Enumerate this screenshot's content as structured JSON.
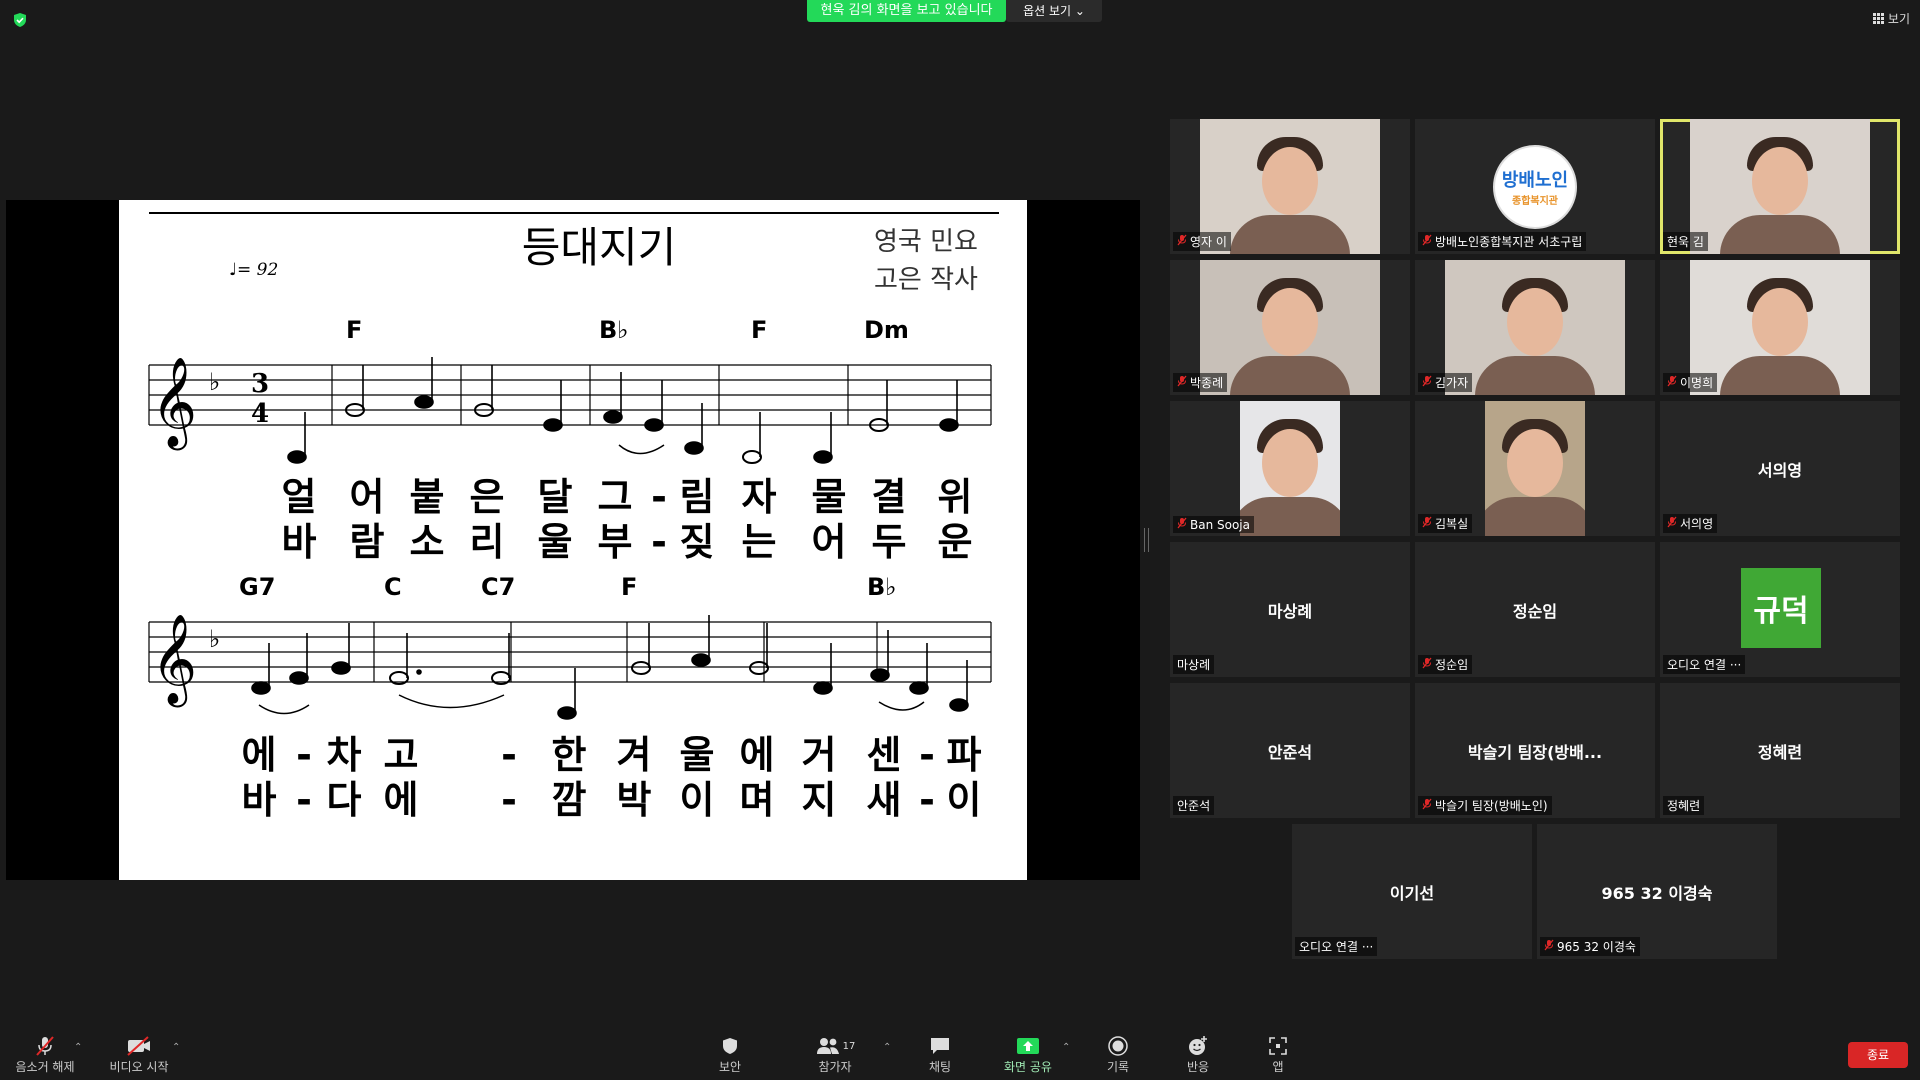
{
  "meeting": {
    "sharing_banner": "현욱 김의 화면을 보고 있습니다",
    "view_options": "옵션 보기",
    "view_button": "보기"
  },
  "sheet": {
    "title": "등대지기",
    "origin": "영국 민요",
    "lyricist": "고은 작사",
    "tempo": "♩= 92",
    "row1_chords": [
      "F",
      "B♭",
      "F",
      "Dm"
    ],
    "row1_lyrics_1": [
      "얼",
      "어",
      "붙",
      "은",
      "달",
      "그",
      "-",
      "림",
      "자",
      "물",
      "결",
      "위"
    ],
    "row1_lyrics_2": [
      "바",
      "람",
      "소",
      "리",
      "울",
      "부",
      "-",
      "짖",
      "는",
      "어",
      "두",
      "운"
    ],
    "row2_chords": [
      "G7",
      "C",
      "C7",
      "F",
      "B♭"
    ],
    "row2_lyrics_1": [
      "에",
      "-",
      "차",
      "고",
      "-",
      "한",
      "겨",
      "울",
      "에",
      "거",
      "센",
      "-",
      "파"
    ],
    "row2_lyrics_2": [
      "바",
      "-",
      "다",
      "에",
      "-",
      "깜",
      "박",
      "이",
      "며",
      "지",
      "새",
      "-",
      "이"
    ]
  },
  "participants": [
    {
      "name": "영자 이",
      "video": true,
      "muted": true,
      "bg": "#d8d0c8"
    },
    {
      "name": "방배노인종합복지관 서초구립",
      "video": true,
      "muted": true,
      "logo_text": "방배노인",
      "logo_sub": "종합복지관",
      "bg": "#ffffff"
    },
    {
      "name": "현욱 김",
      "video": true,
      "muted": false,
      "active": true,
      "bg": "#d9d2cc"
    },
    {
      "name": "박종례",
      "video": true,
      "muted": true,
      "bg": "#c8c0b8"
    },
    {
      "name": "김가자",
      "video": true,
      "muted": true,
      "bg": "#cfc7bf"
    },
    {
      "name": "이명희",
      "video": true,
      "muted": true,
      "bg": "#e0dcd8"
    },
    {
      "name": "Ban Sooja",
      "video": true,
      "muted": true,
      "bg": "#e6e6e8"
    },
    {
      "name": "김복실",
      "video": true,
      "muted": true,
      "bg": "#b7a58a"
    },
    {
      "name": "서의영",
      "video": false,
      "muted": true,
      "center": "서의영"
    },
    {
      "name": "마상례",
      "video": false,
      "muted": false,
      "center": "마상례"
    },
    {
      "name": "정순임",
      "video": false,
      "muted": true,
      "center": "정순임"
    },
    {
      "name": "오디오 연결 ···",
      "video": false,
      "muted": false,
      "avatar": "규덕"
    },
    {
      "name": "안준석",
      "video": false,
      "muted": false,
      "center": "안준석"
    },
    {
      "name": "박슬기 팀장(방배노인)",
      "video": false,
      "muted": true,
      "center": "박슬기 팀장(방배..."
    },
    {
      "name": "정혜련",
      "video": false,
      "muted": false,
      "center": "정혜련"
    },
    {
      "name": "오디오 연결 ···",
      "video": false,
      "muted": false,
      "center": "이기선"
    },
    {
      "name": "965 32 이경숙",
      "video": false,
      "muted": true,
      "center": "965 32 이경숙"
    }
  ],
  "toolbar": {
    "unmute": "음소거 해제",
    "start_video": "비디오 시작",
    "security": "보안",
    "participants": "참가자",
    "participants_count": "17",
    "chat": "채팅",
    "share_screen": "화면 공유",
    "record": "기록",
    "reactions": "반응",
    "apps": "앱",
    "end": "종료"
  },
  "colors": {
    "share_green": "#23d959",
    "active_border": "#e0e66a",
    "mute_red": "#e02828",
    "end_red": "#d92626",
    "avatar_green": "#40a835"
  }
}
